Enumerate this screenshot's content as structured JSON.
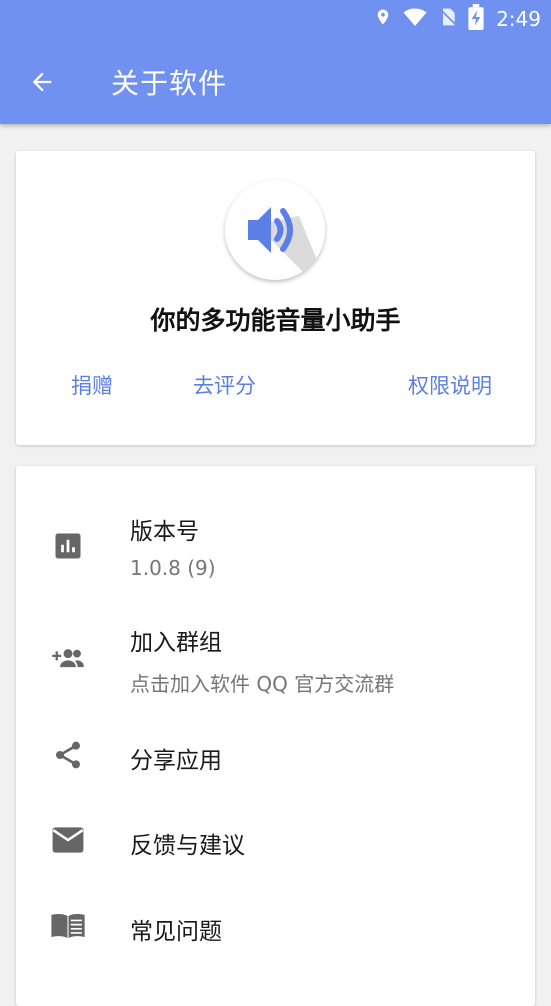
{
  "status_bar": {
    "time": "2:49",
    "icons": [
      "location-icon",
      "wifi-icon",
      "no-sim-icon",
      "battery-charging-icon"
    ]
  },
  "app_bar": {
    "title": "关于软件",
    "back_icon": "arrow-back-icon",
    "color": "#7091ef"
  },
  "about_card": {
    "logo_icon": "volume-speaker-icon",
    "tagline": "你的多功能音量小助手",
    "actions": [
      {
        "label": "捐赠"
      },
      {
        "label": "去评分"
      },
      {
        "label": "权限说明"
      }
    ],
    "link_color": "#5b7fe6"
  },
  "menu": {
    "items": [
      {
        "icon": "bar-chart-icon",
        "title": "版本号",
        "subtitle": "1.0.8 (9)"
      },
      {
        "icon": "group-add-icon",
        "title": "加入群组",
        "subtitle": "点击加入软件 QQ 官方交流群"
      },
      {
        "icon": "share-icon",
        "title": "分享应用"
      },
      {
        "icon": "mail-icon",
        "title": "反馈与建议"
      },
      {
        "icon": "book-icon",
        "title": "常见问题"
      }
    ]
  }
}
